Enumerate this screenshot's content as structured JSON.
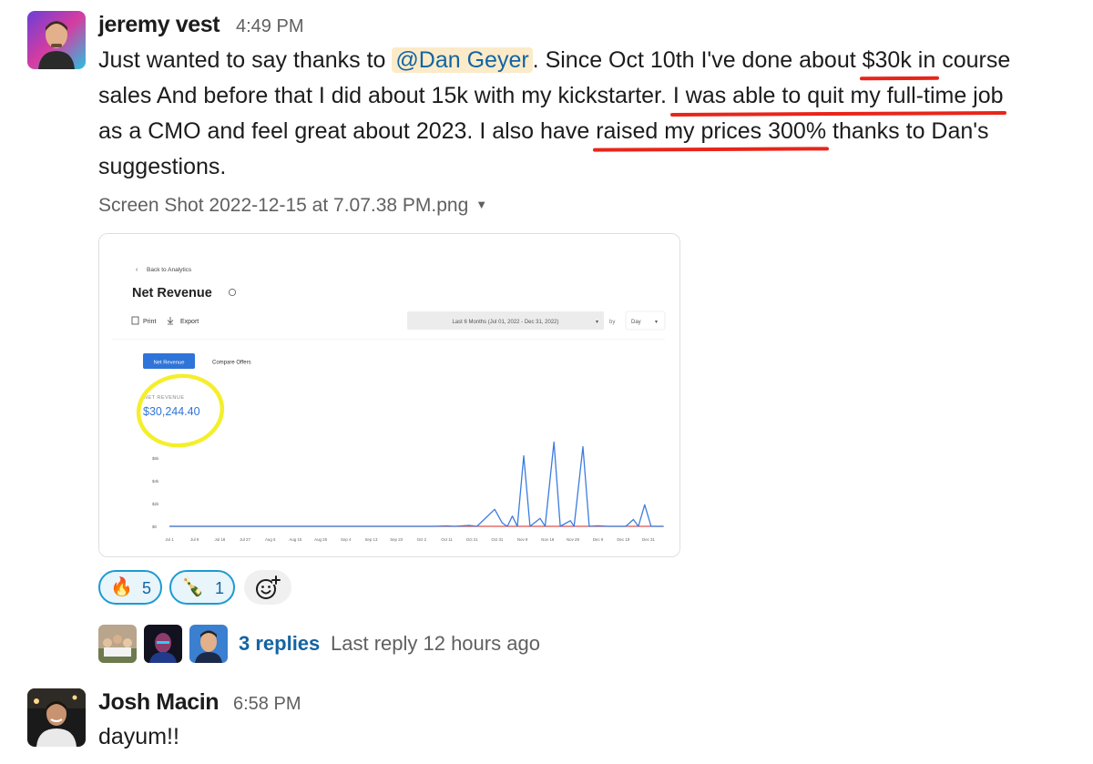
{
  "message1": {
    "author": "jeremy vest",
    "time": "4:49 PM",
    "line1_pre": "Just wanted to say thanks to ",
    "mention": "@Dan Geyer",
    "line1_post": ". Since Oct 10th I've done about ",
    "hl1": "$30k in",
    "line1_end": " course",
    "line2_pre": "sales And before that I did about 15k with my kickstarter. ",
    "hl2": "I was able to quit my full-time job",
    "line3_pre": "as a CMO and feel great about 2023. I also have ",
    "hl3": "raised my prices 300%",
    "line3_post": " thanks to Dan's",
    "line4": "suggestions.",
    "attachment_name": "Screen Shot 2022-12-15 at 7.07.38 PM.png",
    "attachment_caret": "▼"
  },
  "screenshot": {
    "back_link": "Back to Analytics",
    "title": "Net Revenue",
    "print_label": "Print",
    "export_label": "Export",
    "date_range": "Last 6 Months (Jul 01, 2022 - Dec 31, 2022)",
    "by_label": "by",
    "interval": "Day",
    "tab_active": "Net Revenue",
    "tab_other": "Compare Offers",
    "metric_label": "NET REVENUE",
    "metric_value": "$30,244.40",
    "highlight_color": "#f4ef2a",
    "chart_data": {
      "type": "line",
      "ylabels": [
        "$6k",
        "$4k",
        "$2k",
        "$0"
      ],
      "xlabels": [
        "Jul 1",
        "Jul 9",
        "Jul 18",
        "Jul 27",
        "Aug 5",
        "Aug 15",
        "Aug 25",
        "Sep 4",
        "Sep 13",
        "Sep 23",
        "Oct 2",
        "Oct 11",
        "Oct 21",
        "Oct 31",
        "Nov 9",
        "Nov 19",
        "Nov 29",
        "Dec 9",
        "Dec 19",
        "Dec 31"
      ],
      "ylim": [
        0,
        8000
      ],
      "series": [
        {
          "color": "#3b7ce0",
          "points": [
            [
              0,
              0
            ],
            [
              10.5,
              0
            ],
            [
              11,
              40
            ],
            [
              11.3,
              0
            ],
            [
              11.9,
              80
            ],
            [
              12.2,
              0
            ],
            [
              12.9,
              1500
            ],
            [
              13.2,
              300
            ],
            [
              13.4,
              0
            ],
            [
              13.6,
              900
            ],
            [
              13.8,
              0
            ],
            [
              14.05,
              6200
            ],
            [
              14.3,
              0
            ],
            [
              14.7,
              700
            ],
            [
              14.9,
              0
            ],
            [
              15.25,
              7400
            ],
            [
              15.5,
              0
            ],
            [
              15.9,
              500
            ],
            [
              16.05,
              0
            ],
            [
              16.4,
              7000
            ],
            [
              16.65,
              0
            ],
            [
              17,
              50
            ],
            [
              17.4,
              0
            ],
            [
              18.1,
              0
            ],
            [
              18.4,
              600
            ],
            [
              18.6,
              0
            ],
            [
              18.85,
              1900
            ],
            [
              19.1,
              0
            ],
            [
              19.6,
              0
            ]
          ]
        },
        {
          "color": "#d9534f",
          "points": [
            [
              0,
              0
            ],
            [
              19.6,
              0
            ]
          ]
        }
      ]
    }
  },
  "reactions": [
    {
      "emoji": "🔥",
      "count": "5"
    },
    {
      "emoji": "🍾",
      "count": "1"
    }
  ],
  "add_reaction_icon": "emoji-plus-icon",
  "thread": {
    "replies": "3 replies",
    "last_reply": "Last reply 12 hours ago"
  },
  "message2": {
    "author": "Josh Macin",
    "time": "6:58 PM",
    "text": "dayum!!"
  },
  "colors": {
    "link": "#1264a3",
    "mention_bg": "#fcebc9",
    "underline": "#e8251a",
    "reaction_border": "#1d9bd1"
  }
}
